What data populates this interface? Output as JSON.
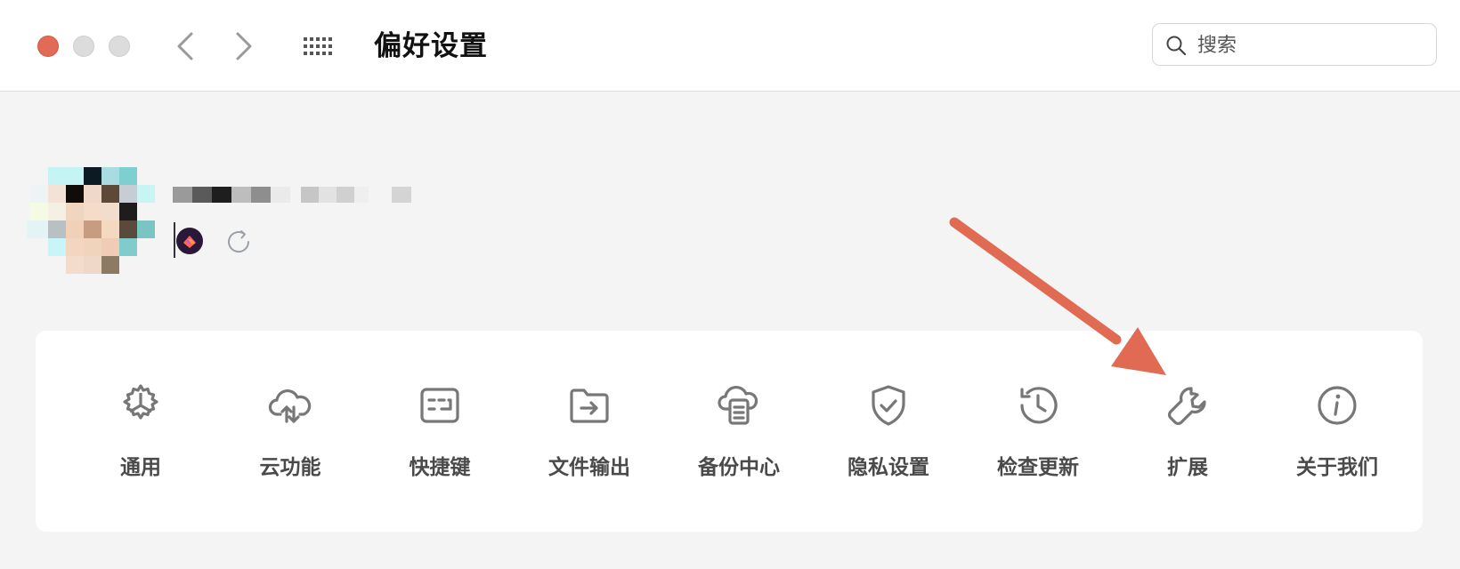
{
  "window": {
    "title": "偏好设置"
  },
  "search": {
    "placeholder": "搜索"
  },
  "settings_items": [
    {
      "id": "general",
      "label": "通用",
      "icon": "gear-icon"
    },
    {
      "id": "cloud",
      "label": "云功能",
      "icon": "cloud-upload-icon"
    },
    {
      "id": "shortcuts",
      "label": "快捷键",
      "icon": "keyboard-icon"
    },
    {
      "id": "export",
      "label": "文件输出",
      "icon": "folder-export-icon"
    },
    {
      "id": "backup",
      "label": "备份中心",
      "icon": "backup-cloud-icon"
    },
    {
      "id": "privacy",
      "label": "隐私设置",
      "icon": "shield-check-icon"
    },
    {
      "id": "update",
      "label": "检查更新",
      "icon": "history-icon"
    },
    {
      "id": "extensions",
      "label": "扩展",
      "icon": "wrench-icon"
    },
    {
      "id": "about",
      "label": "关于我们",
      "icon": "info-icon"
    }
  ],
  "colors": {
    "close_dot": "#e26b58",
    "annotation_arrow": "#e06a52",
    "icon_gray": "#7a7a7a"
  }
}
